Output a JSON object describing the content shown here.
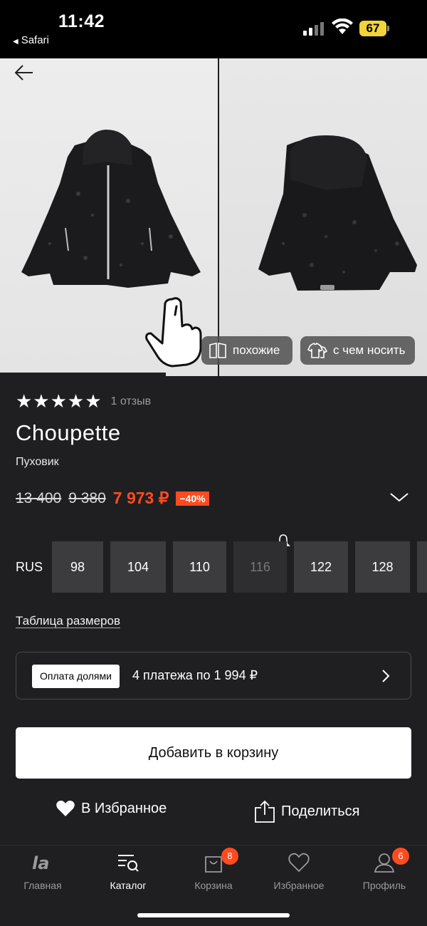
{
  "status_bar": {
    "time": "11:42",
    "back_app": "Safari",
    "battery": "67",
    "battery_color": "#f2d33b"
  },
  "gallery": {
    "photos": [
      "jacket-front",
      "jacket-back"
    ],
    "chips": {
      "similar": "похожие",
      "what_to_wear": "с чем носить"
    }
  },
  "product": {
    "rating_stars": "★★★★★",
    "reviews": "1 отзыв",
    "brand": "Choupette",
    "category": "Пуховик",
    "prices": {
      "old_1": "13 400",
      "old_2": "9 380",
      "current": "7 973 ₽",
      "discount": "−40%"
    },
    "accent_color": "#ff4b1f"
  },
  "sizes": {
    "system": "RUS",
    "items": [
      {
        "label": "98",
        "available": true
      },
      {
        "label": "104",
        "available": true
      },
      {
        "label": "110",
        "available": true
      },
      {
        "label": "116",
        "available": false
      },
      {
        "label": "122",
        "available": true
      },
      {
        "label": "128",
        "available": true
      }
    ],
    "size_table_link": "Таблица размеров"
  },
  "split_payment": {
    "badge": "Оплата долями",
    "text": "4 платежа по 1 994 ₽"
  },
  "actions": {
    "add_to_cart": "Добавить в корзину",
    "favorite": "В Избранное",
    "share": "Поделиться"
  },
  "bottom_nav": {
    "items": [
      {
        "label": "Главная",
        "icon": "la-logo-icon"
      },
      {
        "label": "Каталог",
        "icon": "catalog-search-icon",
        "active": true
      },
      {
        "label": "Корзина",
        "icon": "bag-icon",
        "badge": "8"
      },
      {
        "label": "Избранное",
        "icon": "heart-icon"
      },
      {
        "label": "Профиль",
        "icon": "profile-icon",
        "badge": "6"
      }
    ]
  }
}
